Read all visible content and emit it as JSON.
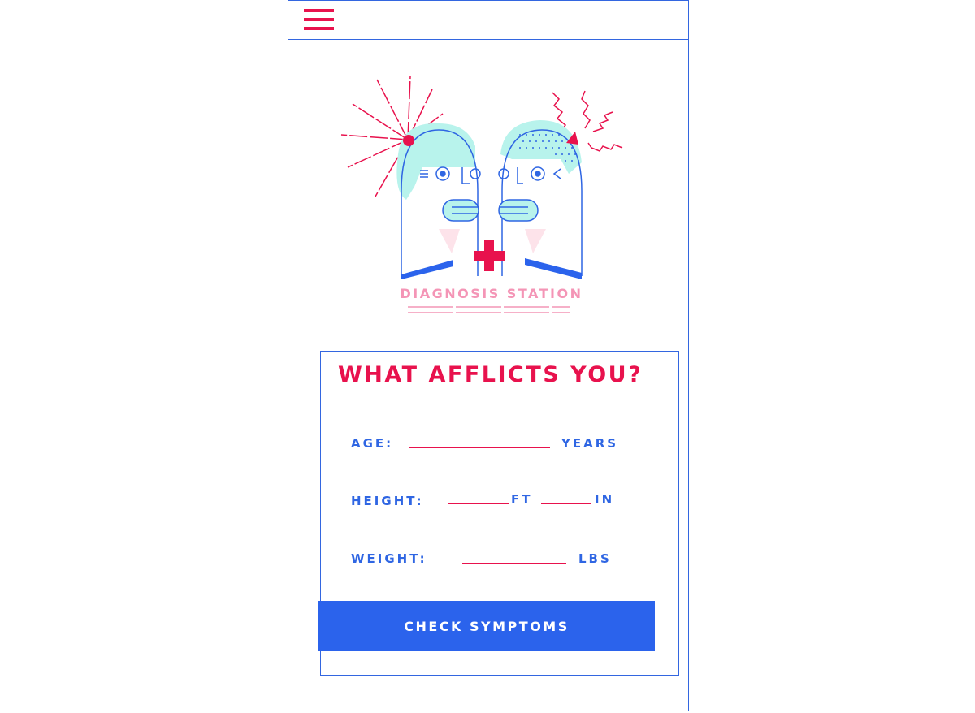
{
  "menu": {
    "icon": "hamburger-menu-icon"
  },
  "hero": {
    "title": "DIAGNOSIS STATION",
    "icon": "two-heads-illustration"
  },
  "form": {
    "title": "WHAT AFFLICTS YOU?",
    "age": {
      "label": "AGE:",
      "value": "",
      "unit": "YEARS"
    },
    "height": {
      "label": "HEIGHT:",
      "ft_value": "",
      "ft_unit": "FT",
      "in_value": "",
      "in_unit": "IN"
    },
    "weight": {
      "label": "WEIGHT:",
      "value": "",
      "unit": "LBS"
    },
    "submit_label": "CHECK SYMPTOMS"
  },
  "colors": {
    "accent_red": "#e8124d",
    "primary_blue": "#2b63ec",
    "outline_blue": "#3366e0",
    "pink": "#f495b6",
    "mint": "#b8f3ec"
  }
}
